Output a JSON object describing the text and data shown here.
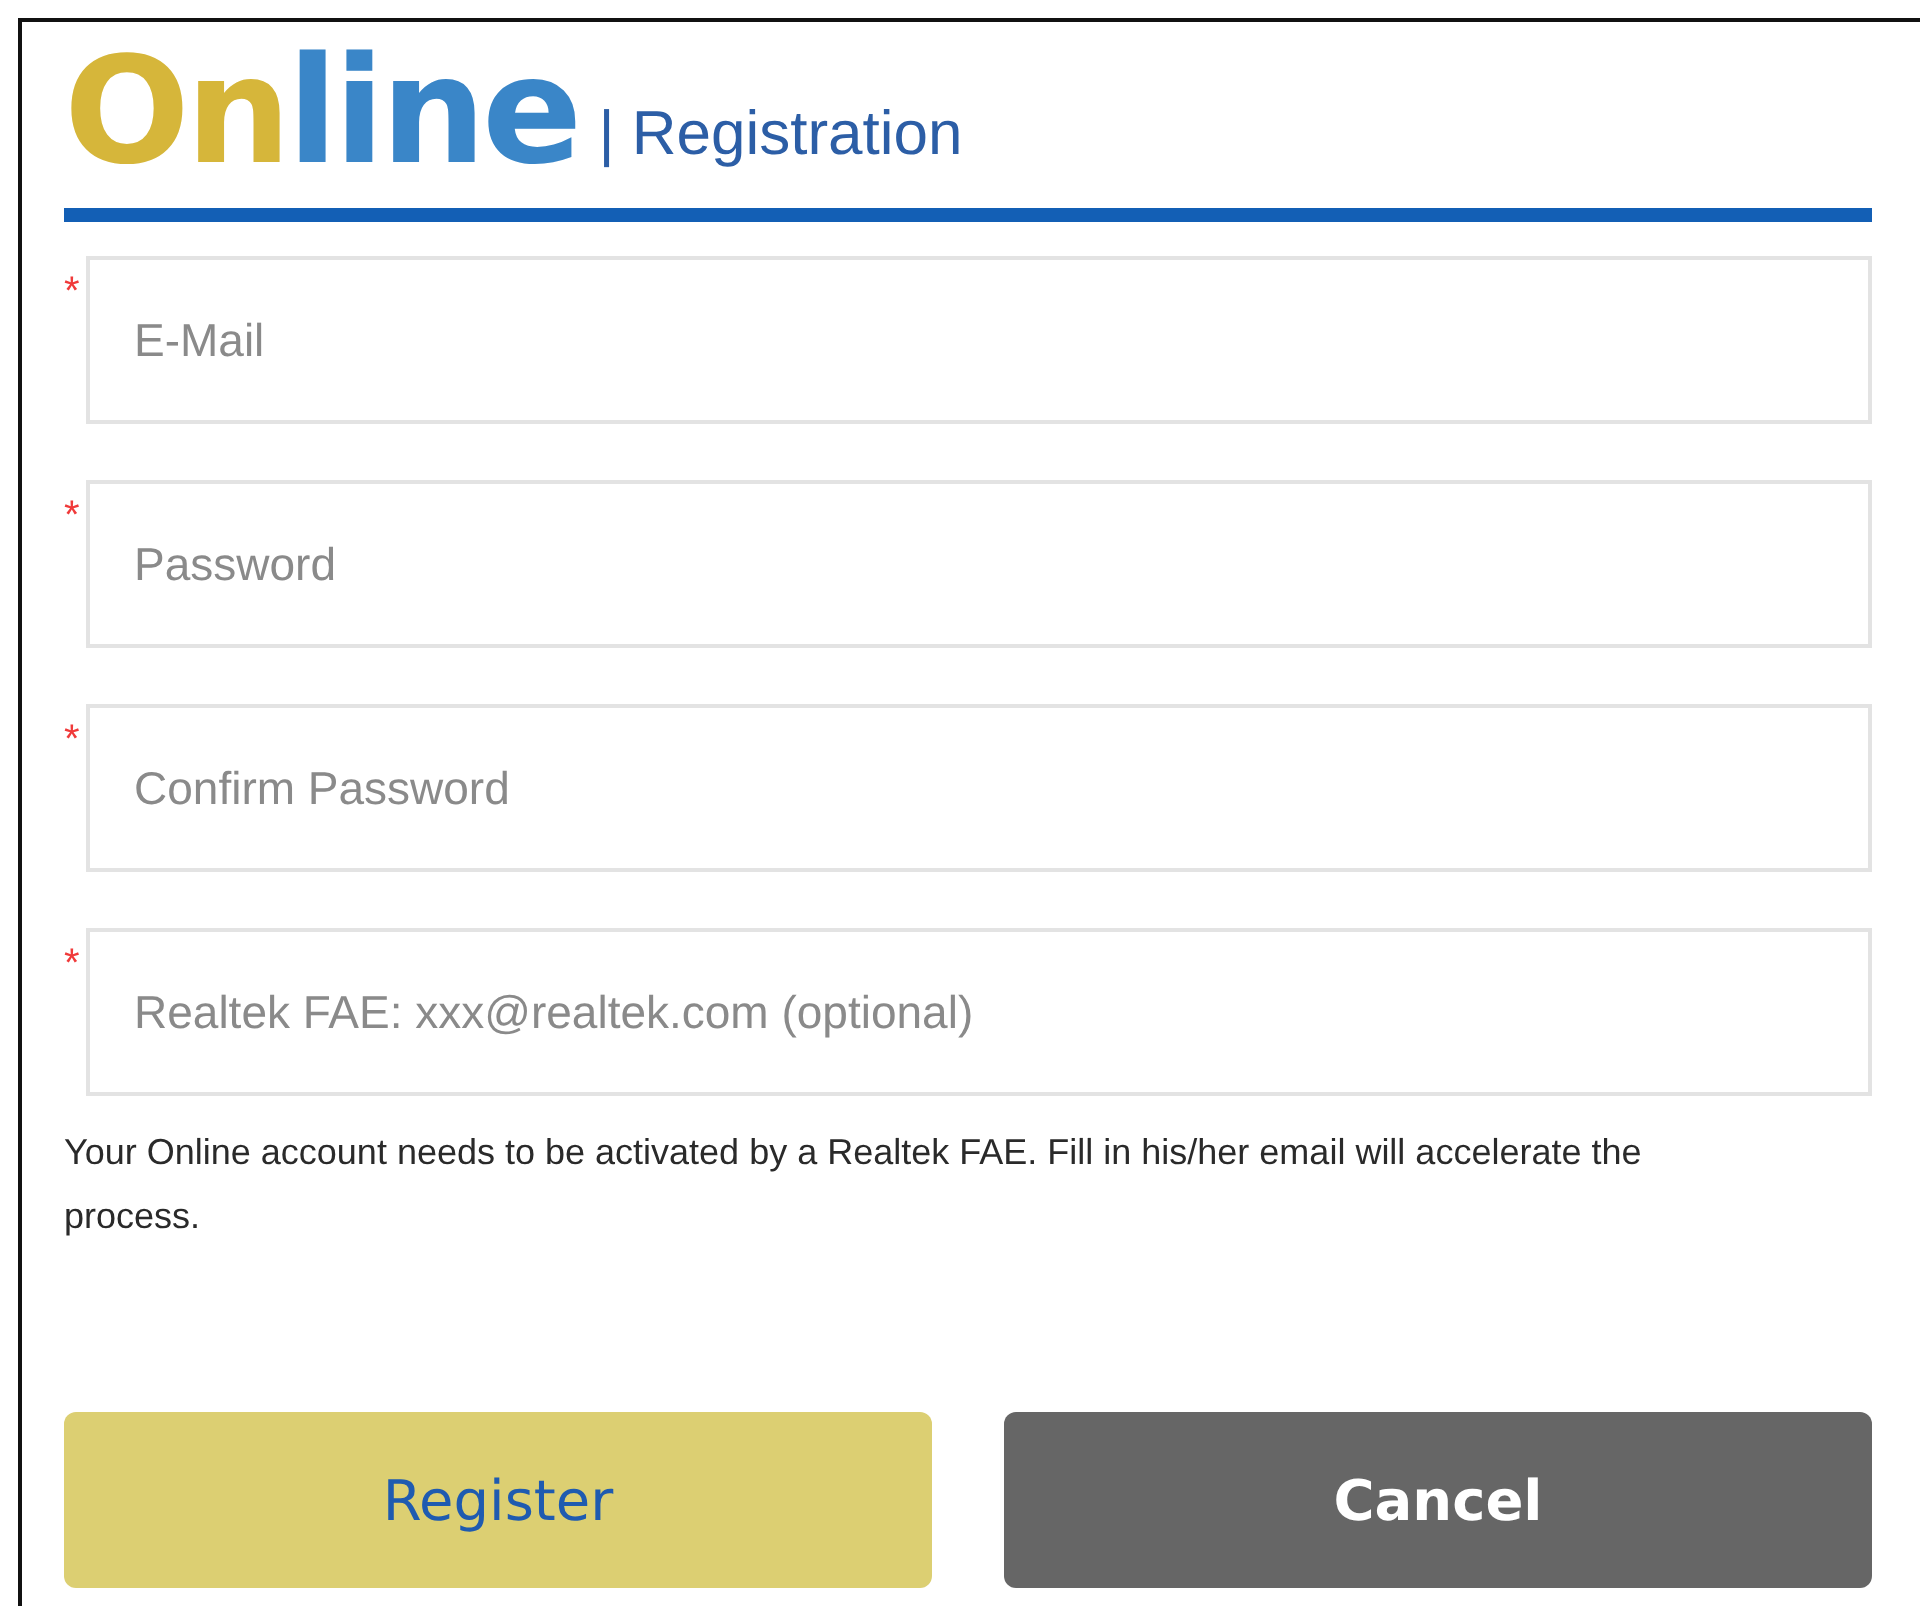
{
  "logo": {
    "parts": [
      {
        "text": "On",
        "color": "#d6b63a"
      },
      {
        "text": "line",
        "color": "#3a86c8"
      }
    ]
  },
  "title": "| Registration",
  "fields": [
    {
      "mark": "*",
      "placeholder": "E-Mail"
    },
    {
      "mark": "*",
      "placeholder": "Password"
    },
    {
      "mark": "*",
      "placeholder": "Confirm Password"
    },
    {
      "mark": "*",
      "placeholder": "Realtek FAE: xxx@realtek.com (optional)"
    }
  ],
  "help_text": "Your Online account needs to be activated by a Realtek FAE. Fill in his/her email will accelerate the process.",
  "buttons": [
    {
      "kind": "primary",
      "label": "Register"
    },
    {
      "kind": "secondary",
      "label": "Cancel"
    }
  ]
}
